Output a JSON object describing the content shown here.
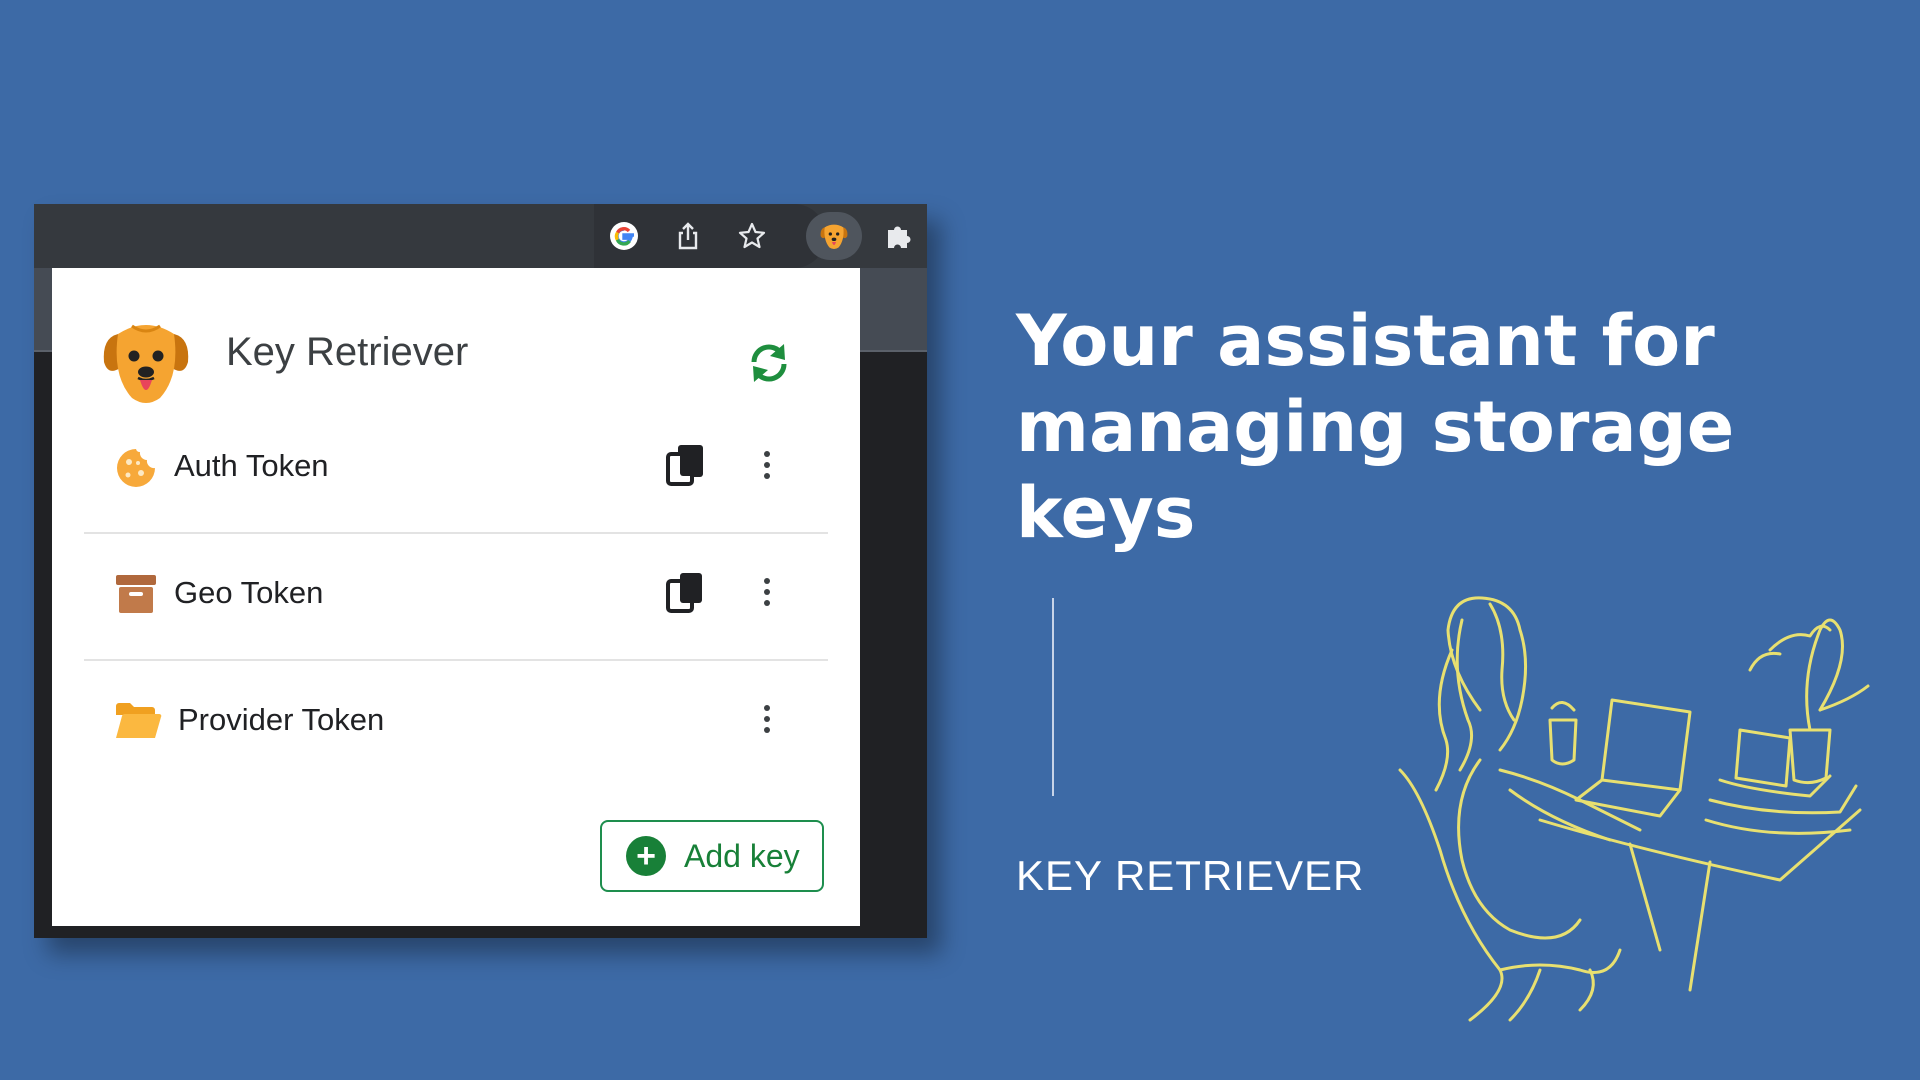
{
  "browser": {
    "toolbar_icons": [
      "google-icon",
      "share-icon",
      "bookmark-star-icon",
      "dog-extension-icon",
      "puzzle-extensions-icon"
    ]
  },
  "popup": {
    "title": "Key Retriever",
    "logo": "golden-retriever-logo",
    "refresh_icon": "refresh-icon",
    "keys": [
      {
        "label": "Auth Token",
        "icon": "cookie-icon",
        "copyable": true
      },
      {
        "label": "Geo Token",
        "icon": "archive-box-icon",
        "copyable": true
      },
      {
        "label": "Provider Token",
        "icon": "open-folder-icon",
        "copyable": false
      }
    ],
    "add_button_label": "Add key"
  },
  "marketing": {
    "headline": "Your assistant for managing storage keys",
    "brand": "KEY RETRIEVER"
  },
  "colors": {
    "background": "#3d6aa6",
    "accent_green": "#188038",
    "illustration_line": "#e8e070"
  }
}
